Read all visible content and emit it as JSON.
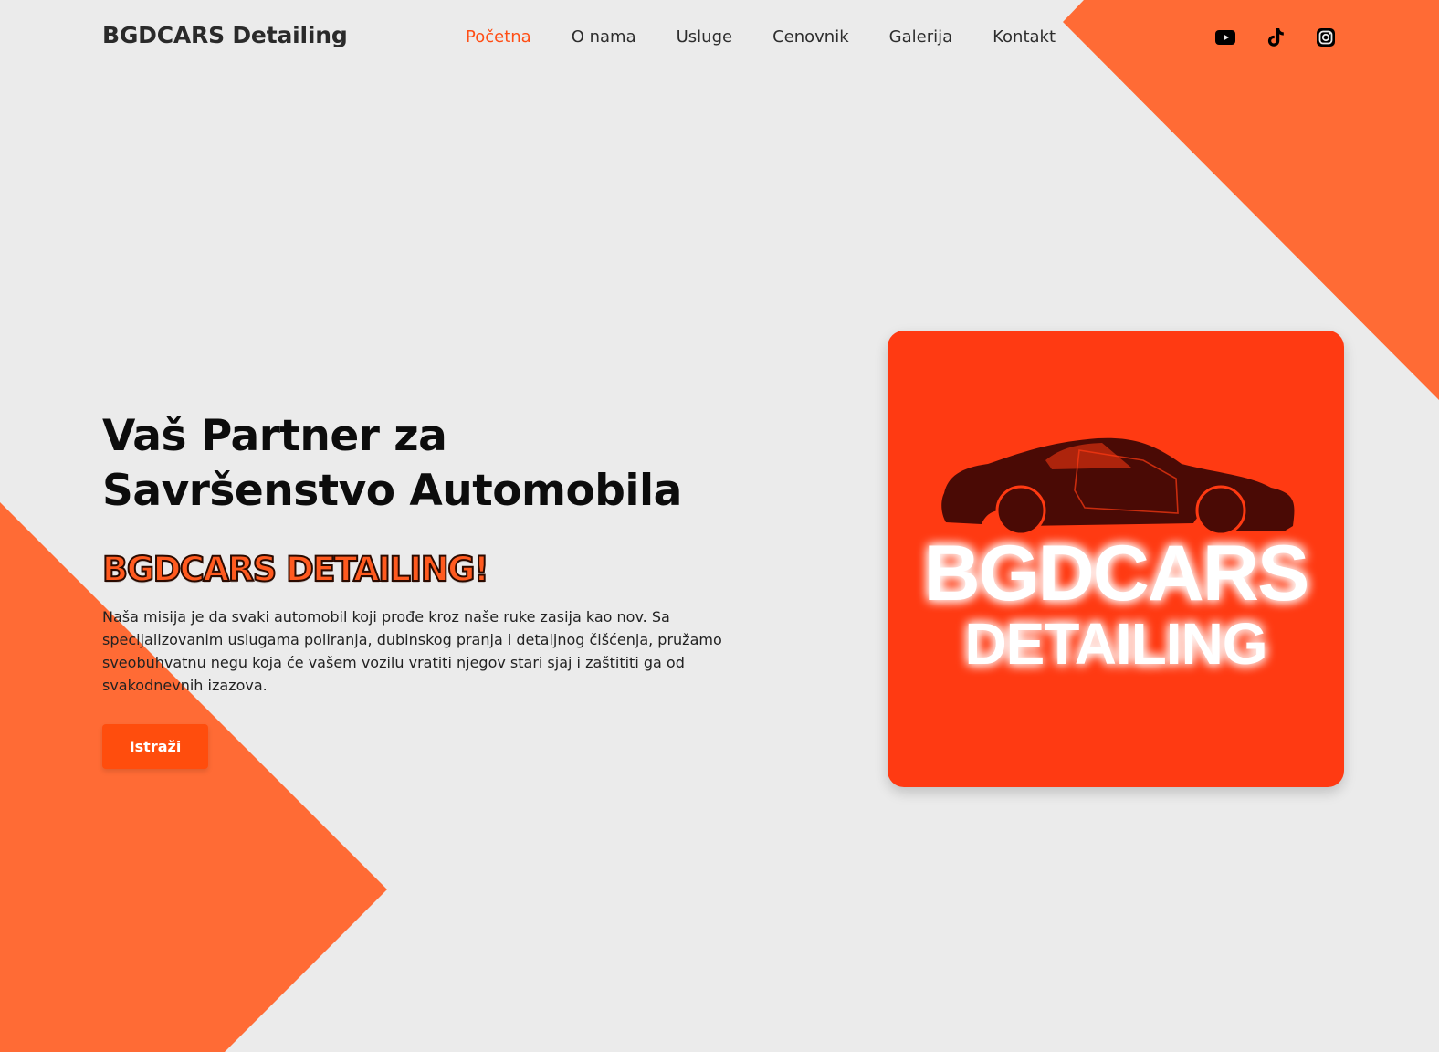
{
  "header": {
    "brand": "BGDCARS Detailing",
    "nav": [
      {
        "label": "Početna",
        "active": true
      },
      {
        "label": "O nama",
        "active": false
      },
      {
        "label": "Usluge",
        "active": false
      },
      {
        "label": "Cenovnik",
        "active": false
      },
      {
        "label": "Galerija",
        "active": false
      },
      {
        "label": "Kontakt",
        "active": false
      }
    ],
    "social_icons": [
      "youtube-icon",
      "tiktok-icon",
      "instagram-icon"
    ]
  },
  "hero": {
    "title_line1": "Vaš Partner za",
    "title_line2": "Savršenstvo Automobila",
    "brand_tagline": "BGDCARS DETAILING!",
    "description": "Naša misija je da svaki automobil koji prođe kroz naše ruke zasija kao nov. Sa specijalizovanim uslugama poliranja, dubinskog pranja i detaljnog čišćenja, pružamo sveobuhvatnu negu koja će vašem vozilu vratiti njegov stari sjaj i zaštititi ga od svakodnevnih izazova.",
    "cta_label": "Istraži"
  },
  "logo": {
    "line1": "BGDCARS",
    "line2": "DETAILING"
  },
  "colors": {
    "accent": "#ff4d14",
    "shape": "#ff6b35",
    "logo_bg": "#ff3a12",
    "background": "#ebebeb"
  }
}
